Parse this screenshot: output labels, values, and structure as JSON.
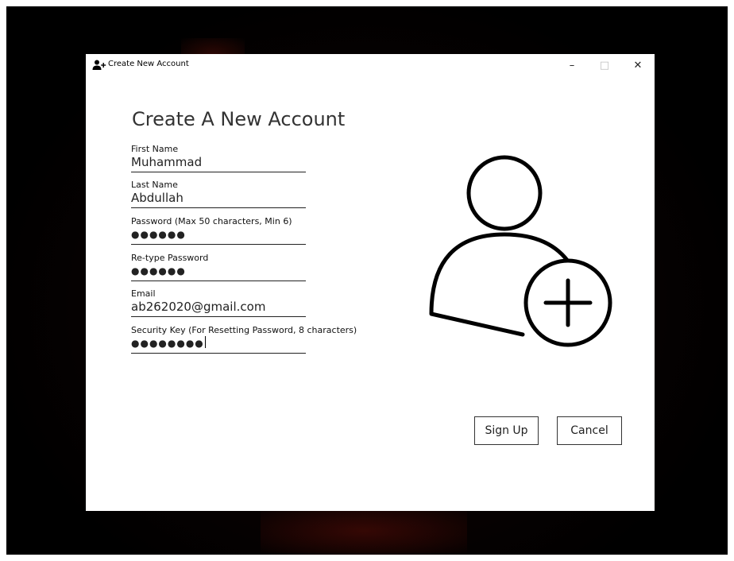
{
  "window": {
    "title": "Create New Account",
    "minimize_glyph": "–",
    "maximize_glyph": "□",
    "close_glyph": "✕"
  },
  "form": {
    "heading": "Create A New Account",
    "fields": [
      {
        "label": "First Name",
        "value": "Muhammad"
      },
      {
        "label": "Last Name",
        "value": "Abdullah"
      },
      {
        "label": "Password (Max 50 characters, Min 6)",
        "value": "●●●●●●"
      },
      {
        "label": "Re-type Password",
        "value": "●●●●●●"
      },
      {
        "label": "Email",
        "value": "ab262020@gmail.com"
      },
      {
        "label": "Security Key (For Resetting Password, 8 characters)",
        "value": "●●●●●●●●"
      }
    ]
  },
  "buttons": {
    "sign_up": "Sign Up",
    "cancel": "Cancel"
  },
  "icons": {
    "title_icon": "add-user-icon",
    "illustration": "add-user-icon"
  },
  "colors": {
    "heading": "#333333",
    "border": "#222222",
    "window_bg": "#ffffff"
  }
}
